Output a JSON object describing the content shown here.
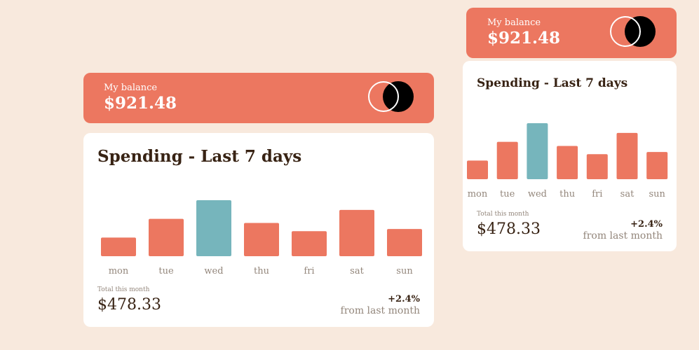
{
  "balance": {
    "label": "My balance",
    "amount": "$921.48"
  },
  "spending": {
    "title": "Spending - Last 7 days",
    "total_label": "Total this month",
    "total_amount": "$478.33",
    "change_value": "+2.4%",
    "change_caption": "from last month"
  },
  "colors": {
    "accent": "#ec7760",
    "active_bar": "#76b5bc",
    "background": "#f8e9dd",
    "dark_text": "#382314",
    "muted_text": "#93867b"
  },
  "icons": {
    "brand_logo": "overlapping-circles-logo"
  },
  "chart_data": {
    "type": "bar",
    "categories": [
      "mon",
      "tue",
      "wed",
      "thu",
      "fri",
      "sat",
      "sun"
    ],
    "values": [
      17.45,
      34.91,
      52.36,
      31.07,
      23.39,
      43.28,
      25.48
    ],
    "highlight_index": 2,
    "title": "Spending - Last 7 days",
    "xlabel": "",
    "ylabel": "",
    "ylim": [
      0,
      52.36
    ],
    "grid": false,
    "legend": "none"
  }
}
